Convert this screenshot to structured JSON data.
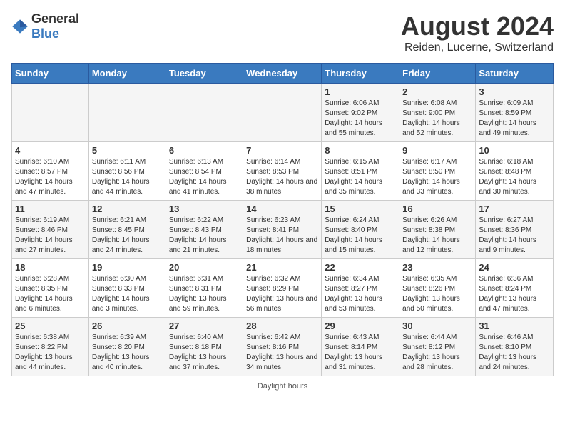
{
  "logo": {
    "text_general": "General",
    "text_blue": "Blue"
  },
  "title": "August 2024",
  "subtitle": "Reiden, Lucerne, Switzerland",
  "days_of_week": [
    "Sunday",
    "Monday",
    "Tuesday",
    "Wednesday",
    "Thursday",
    "Friday",
    "Saturday"
  ],
  "weeks": [
    [
      {
        "day": "",
        "info": ""
      },
      {
        "day": "",
        "info": ""
      },
      {
        "day": "",
        "info": ""
      },
      {
        "day": "",
        "info": ""
      },
      {
        "day": "1",
        "info": "Sunrise: 6:06 AM\nSunset: 9:02 PM\nDaylight: 14 hours and 55 minutes."
      },
      {
        "day": "2",
        "info": "Sunrise: 6:08 AM\nSunset: 9:00 PM\nDaylight: 14 hours and 52 minutes."
      },
      {
        "day": "3",
        "info": "Sunrise: 6:09 AM\nSunset: 8:59 PM\nDaylight: 14 hours and 49 minutes."
      }
    ],
    [
      {
        "day": "4",
        "info": "Sunrise: 6:10 AM\nSunset: 8:57 PM\nDaylight: 14 hours and 47 minutes."
      },
      {
        "day": "5",
        "info": "Sunrise: 6:11 AM\nSunset: 8:56 PM\nDaylight: 14 hours and 44 minutes."
      },
      {
        "day": "6",
        "info": "Sunrise: 6:13 AM\nSunset: 8:54 PM\nDaylight: 14 hours and 41 minutes."
      },
      {
        "day": "7",
        "info": "Sunrise: 6:14 AM\nSunset: 8:53 PM\nDaylight: 14 hours and 38 minutes."
      },
      {
        "day": "8",
        "info": "Sunrise: 6:15 AM\nSunset: 8:51 PM\nDaylight: 14 hours and 35 minutes."
      },
      {
        "day": "9",
        "info": "Sunrise: 6:17 AM\nSunset: 8:50 PM\nDaylight: 14 hours and 33 minutes."
      },
      {
        "day": "10",
        "info": "Sunrise: 6:18 AM\nSunset: 8:48 PM\nDaylight: 14 hours and 30 minutes."
      }
    ],
    [
      {
        "day": "11",
        "info": "Sunrise: 6:19 AM\nSunset: 8:46 PM\nDaylight: 14 hours and 27 minutes."
      },
      {
        "day": "12",
        "info": "Sunrise: 6:21 AM\nSunset: 8:45 PM\nDaylight: 14 hours and 24 minutes."
      },
      {
        "day": "13",
        "info": "Sunrise: 6:22 AM\nSunset: 8:43 PM\nDaylight: 14 hours and 21 minutes."
      },
      {
        "day": "14",
        "info": "Sunrise: 6:23 AM\nSunset: 8:41 PM\nDaylight: 14 hours and 18 minutes."
      },
      {
        "day": "15",
        "info": "Sunrise: 6:24 AM\nSunset: 8:40 PM\nDaylight: 14 hours and 15 minutes."
      },
      {
        "day": "16",
        "info": "Sunrise: 6:26 AM\nSunset: 8:38 PM\nDaylight: 14 hours and 12 minutes."
      },
      {
        "day": "17",
        "info": "Sunrise: 6:27 AM\nSunset: 8:36 PM\nDaylight: 14 hours and 9 minutes."
      }
    ],
    [
      {
        "day": "18",
        "info": "Sunrise: 6:28 AM\nSunset: 8:35 PM\nDaylight: 14 hours and 6 minutes."
      },
      {
        "day": "19",
        "info": "Sunrise: 6:30 AM\nSunset: 8:33 PM\nDaylight: 14 hours and 3 minutes."
      },
      {
        "day": "20",
        "info": "Sunrise: 6:31 AM\nSunset: 8:31 PM\nDaylight: 13 hours and 59 minutes."
      },
      {
        "day": "21",
        "info": "Sunrise: 6:32 AM\nSunset: 8:29 PM\nDaylight: 13 hours and 56 minutes."
      },
      {
        "day": "22",
        "info": "Sunrise: 6:34 AM\nSunset: 8:27 PM\nDaylight: 13 hours and 53 minutes."
      },
      {
        "day": "23",
        "info": "Sunrise: 6:35 AM\nSunset: 8:26 PM\nDaylight: 13 hours and 50 minutes."
      },
      {
        "day": "24",
        "info": "Sunrise: 6:36 AM\nSunset: 8:24 PM\nDaylight: 13 hours and 47 minutes."
      }
    ],
    [
      {
        "day": "25",
        "info": "Sunrise: 6:38 AM\nSunset: 8:22 PM\nDaylight: 13 hours and 44 minutes."
      },
      {
        "day": "26",
        "info": "Sunrise: 6:39 AM\nSunset: 8:20 PM\nDaylight: 13 hours and 40 minutes."
      },
      {
        "day": "27",
        "info": "Sunrise: 6:40 AM\nSunset: 8:18 PM\nDaylight: 13 hours and 37 minutes."
      },
      {
        "day": "28",
        "info": "Sunrise: 6:42 AM\nSunset: 8:16 PM\nDaylight: 13 hours and 34 minutes."
      },
      {
        "day": "29",
        "info": "Sunrise: 6:43 AM\nSunset: 8:14 PM\nDaylight: 13 hours and 31 minutes."
      },
      {
        "day": "30",
        "info": "Sunrise: 6:44 AM\nSunset: 8:12 PM\nDaylight: 13 hours and 28 minutes."
      },
      {
        "day": "31",
        "info": "Sunrise: 6:46 AM\nSunset: 8:10 PM\nDaylight: 13 hours and 24 minutes."
      }
    ]
  ],
  "footer": "Daylight hours"
}
